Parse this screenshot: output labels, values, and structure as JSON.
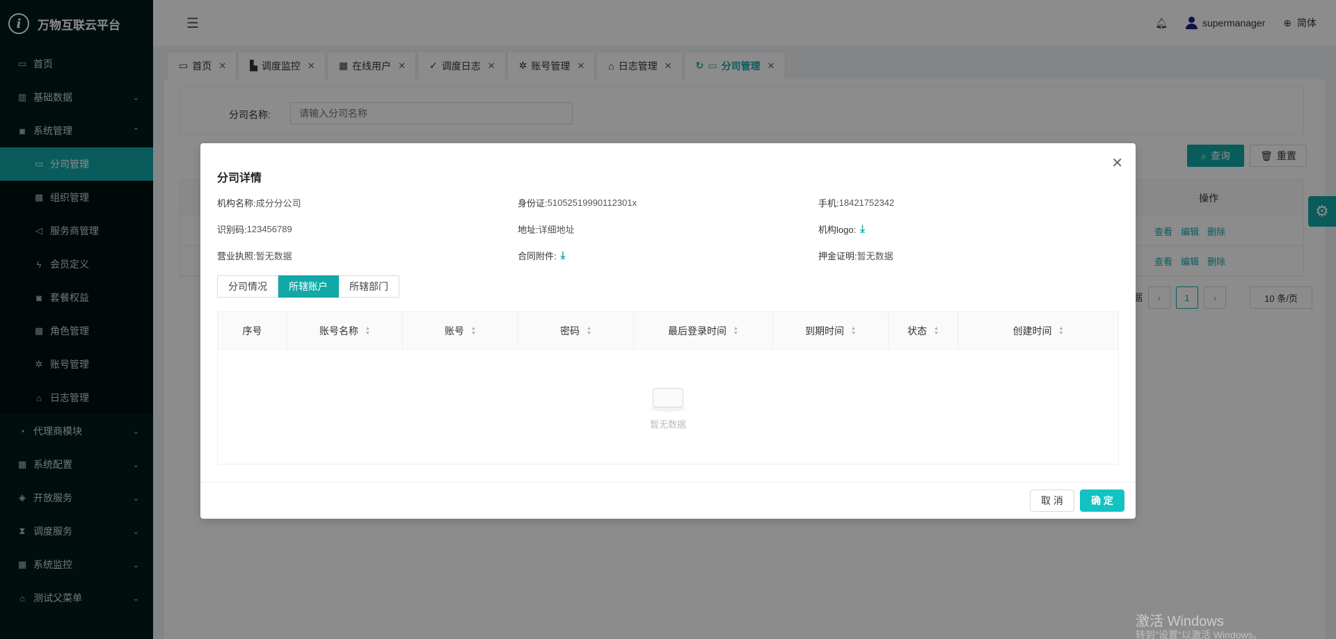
{
  "app": {
    "title": "万物互联云平台"
  },
  "sidebar": {
    "items": [
      {
        "label": "首页",
        "icon": "calendar-icon"
      },
      {
        "label": "基础数据",
        "icon": "barcode-icon",
        "arrow": "⌄"
      },
      {
        "label": "系统管理",
        "icon": "camera-icon",
        "arrow": "⌃"
      }
    ],
    "subitems": [
      {
        "label": "分司管理",
        "icon": "calendar-icon",
        "active": true
      },
      {
        "label": "组织管理",
        "icon": "grid-icon"
      },
      {
        "label": "服务商管理",
        "icon": "speaker-icon"
      },
      {
        "label": "会员定义",
        "icon": "bolt-icon"
      },
      {
        "label": "套餐权益",
        "icon": "camera-icon"
      },
      {
        "label": "角色管理",
        "icon": "grid-icon"
      },
      {
        "label": "账号管理",
        "icon": "bug-icon"
      },
      {
        "label": "日志管理",
        "icon": "home-icon"
      }
    ],
    "bottom": [
      {
        "label": "代理商模块",
        "icon": "bell-icon",
        "arrow": "⌄"
      },
      {
        "label": "系统配置",
        "icon": "grid-icon",
        "arrow": "⌄"
      },
      {
        "label": "开放服务",
        "icon": "tag-icon",
        "arrow": "⌄"
      },
      {
        "label": "调度服务",
        "icon": "hourglass-icon",
        "arrow": "⌄"
      },
      {
        "label": "系统监控",
        "icon": "grid-icon",
        "arrow": "⌄"
      },
      {
        "label": "测试父菜单",
        "icon": "bank-icon",
        "arrow": "⌄"
      }
    ]
  },
  "header": {
    "username": "supermanager",
    "language": "简体"
  },
  "tabs": [
    {
      "label": "首页",
      "icon": "calendar-icon"
    },
    {
      "label": "调度监控",
      "icon": "chart-icon"
    },
    {
      "label": "在线用户",
      "icon": "grid-icon"
    },
    {
      "label": "调度日志",
      "icon": "check-icon"
    },
    {
      "label": "账号管理",
      "icon": "bug-icon"
    },
    {
      "label": "日志管理",
      "icon": "home-icon"
    },
    {
      "label": "分司管理",
      "icon": "calendar-icon",
      "active": true
    }
  ],
  "search": {
    "label": "分司名称:",
    "placeholder": "请输入分司名称",
    "query_label": "查询",
    "reset_label": "重置"
  },
  "table": {
    "op_header": "操作",
    "actions": [
      "查看",
      "编辑",
      "删除"
    ],
    "pager_prefix": "据",
    "current_page": "1",
    "page_size": "10 条/页"
  },
  "modal": {
    "title": "分司详情",
    "fields": {
      "org_name_label": "机构名称:",
      "org_name": "成分分公司",
      "id_card_label": "身份证:",
      "id_card": "51052519990112301x",
      "phone_label": "手机:",
      "phone": "18421752342",
      "code_label": "识别码:",
      "code": "123456789",
      "address_label": "地址:",
      "address": "详细地址",
      "logo_label": "机构logo:",
      "license_label": "营业执照:",
      "license": "暂无数据",
      "contract_label": "合同附件:",
      "deposit_label": "押金证明:",
      "deposit": "暂无数据"
    },
    "segments": [
      "分司情况",
      "所辖账户",
      "所辖部门"
    ],
    "active_segment": "所辖账户",
    "columns": [
      "序号",
      "账号名称",
      "账号",
      "密码",
      "最后登录时间",
      "到期时间",
      "状态",
      "创建时间"
    ],
    "empty_text": "暂无数据",
    "cancel_label": "取 消",
    "ok_label": "确 定"
  },
  "watermark": {
    "line1": "激活 Windows",
    "line2": "转到\"设置\"以激活 Windows。"
  },
  "colors": {
    "accent": "#13a8a8",
    "sidebar_bg": "#001a1a"
  }
}
